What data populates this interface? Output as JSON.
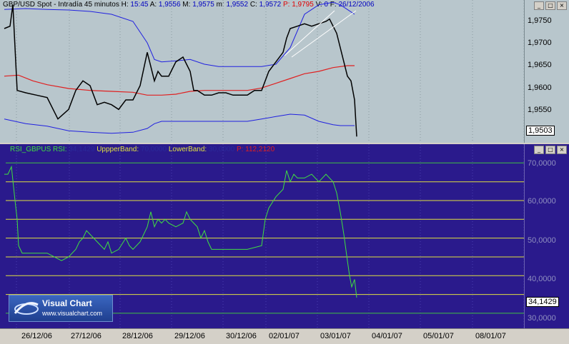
{
  "top_pane": {
    "header": {
      "symbol": "GBP/USD Spot - Intradía 45 minutos",
      "h_label": "H:",
      "h_value": "15:45",
      "a_label": "A:",
      "a_value": "1,9556",
      "m_label": "M:",
      "m_value": "1,9575",
      "mm_label": "m:",
      "mm_value": "1,9552",
      "c_label": "C:",
      "c_value": "1,9572",
      "p_label": "P:",
      "p_value": "1,9795",
      "v_label": "V:",
      "v_value": "0",
      "f_label": "F:",
      "f_value": "26/12/2006"
    },
    "axis_ticks": [
      "1,9750",
      "1,9700",
      "1,9650",
      "1,9600",
      "1,9550"
    ],
    "current_price": "1,9503",
    "window_buttons": [
      "_",
      "□",
      "×"
    ]
  },
  "rsi_pane": {
    "header": {
      "name": "RSI_GBPUS RSI:",
      "rsi_value": "34,1429",
      "upper_label": "UppperBand:",
      "upper_value": "70,0000",
      "lower_label": "LowerBand:",
      "lower_value": "30,0000",
      "p_label": "P:",
      "p_value": "112,2120"
    },
    "axis_ticks": [
      "70,0000",
      "60,0000",
      "50,0000",
      "40,0000",
      "30,0000"
    ],
    "current_value": "34,1429",
    "window_buttons": [
      "_",
      "□",
      "×"
    ]
  },
  "date_axis": [
    "26/12/06",
    "27/12/06",
    "28/12/06",
    "29/12/06",
    "30/12/06",
    "02/01/07",
    "03/01/07",
    "04/01/07",
    "05/01/07",
    "08/01/07"
  ],
  "logo": {
    "title": "Visual Chart",
    "url": "www.visualchart.com"
  },
  "colors": {
    "price_bg": "#b8c6cc",
    "rsi_bg": "#2a1a8c",
    "bands": "#2020e0",
    "ma": "#e02020",
    "rsi_line": "#40e040",
    "levels": "#e0e040"
  },
  "chart_data": [
    {
      "type": "line",
      "series": [
        {
          "name": "GBP/USD Spot",
          "x": [
            0,
            8,
            12,
            18,
            30,
            45,
            60,
            75,
            90,
            100,
            110,
            120,
            130,
            140,
            150,
            160,
            170,
            180,
            190,
            200,
            210,
            215,
            220,
            230,
            240,
            250,
            260,
            265,
            270,
            280,
            290,
            300,
            310,
            320,
            330,
            340,
            350,
            360,
            370,
            380,
            390,
            395,
            400,
            410,
            420,
            430,
            440,
            450,
            455,
            460,
            465,
            470,
            475,
            480,
            485,
            490,
            493
          ],
          "values": [
            1.973,
            1.9735,
            1.978,
            1.96,
            1.9595,
            1.959,
            1.9585,
            1.954,
            1.956,
            1.96,
            1.962,
            1.961,
            1.957,
            1.9575,
            1.957,
            1.956,
            1.958,
            1.958,
            1.961,
            1.968,
            1.962,
            1.964,
            1.963,
            1.963,
            1.966,
            1.967,
            1.964,
            1.96,
            1.96,
            1.959,
            1.959,
            1.9595,
            1.9595,
            1.959,
            1.959,
            1.959,
            1.96,
            1.96,
            1.964,
            1.966,
            1.968,
            1.971,
            1.973,
            1.9735,
            1.974,
            1.9735,
            1.974,
            1.9745,
            1.975,
            1.9735,
            1.972,
            1.969,
            1.966,
            1.963,
            1.962,
            1.958,
            1.9503
          ]
        },
        {
          "name": "Upper band",
          "x": [
            0,
            30,
            60,
            90,
            120,
            150,
            180,
            200,
            210,
            220,
            240,
            260,
            280,
            300,
            320,
            340,
            360,
            380,
            400,
            420,
            440,
            460,
            470,
            480,
            490
          ],
          "values": [
            1.977,
            1.9772,
            1.977,
            1.9769,
            1.9766,
            1.976,
            1.9745,
            1.97,
            1.9665,
            1.966,
            1.9662,
            1.9665,
            1.9655,
            1.965,
            1.965,
            1.965,
            1.965,
            1.9655,
            1.969,
            1.976,
            1.978,
            1.9785,
            1.978,
            1.977,
            1.976
          ]
        },
        {
          "name": "Lower band",
          "x": [
            0,
            30,
            60,
            90,
            120,
            150,
            180,
            200,
            210,
            220,
            240,
            260,
            280,
            300,
            320,
            340,
            360,
            380,
            400,
            420,
            440,
            460,
            470,
            480,
            490
          ],
          "values": [
            1.954,
            1.953,
            1.9525,
            1.9515,
            1.9512,
            1.951,
            1.9512,
            1.952,
            1.953,
            1.9535,
            1.9535,
            1.9535,
            1.9535,
            1.9535,
            1.9535,
            1.9535,
            1.954,
            1.9545,
            1.955,
            1.9548,
            1.9535,
            1.9528,
            1.9526,
            1.9526,
            1.9526
          ]
        },
        {
          "name": "Moving average",
          "x": [
            0,
            20,
            40,
            60,
            90,
            120,
            150,
            180,
            200,
            220,
            240,
            260,
            280,
            300,
            320,
            340,
            360,
            380,
            400,
            420,
            440,
            460,
            480,
            490
          ],
          "values": [
            1.963,
            1.9632,
            1.962,
            1.9612,
            1.9604,
            1.96,
            1.9598,
            1.9596,
            1.959,
            1.959,
            1.9592,
            1.9598,
            1.96,
            1.96,
            1.96,
            1.96,
            1.9605,
            1.9615,
            1.9625,
            1.9635,
            1.964,
            1.9648,
            1.9652,
            1.9652
          ]
        }
      ],
      "ylim": [
        1.949,
        1.979
      ]
    },
    {
      "type": "line",
      "series": [
        {
          "name": "RSI",
          "x": [
            0,
            5,
            10,
            15,
            18,
            20,
            25,
            40,
            60,
            80,
            90,
            100,
            105,
            110,
            115,
            120,
            125,
            130,
            140,
            145,
            150,
            160,
            170,
            175,
            180,
            190,
            200,
            205,
            210,
            215,
            220,
            225,
            230,
            240,
            250,
            255,
            260,
            265,
            270,
            275,
            280,
            285,
            290,
            300,
            320,
            340,
            360,
            365,
            370,
            380,
            390,
            395,
            400,
            405,
            410,
            420,
            430,
            440,
            450,
            460,
            465,
            470,
            475,
            480,
            483,
            486,
            490,
            493
          ],
          "values": [
            67,
            67,
            69,
            60,
            55,
            48,
            46,
            46,
            46,
            44,
            45,
            47,
            49,
            50,
            52,
            51,
            50,
            49,
            47,
            49,
            46,
            47,
            50,
            48,
            47,
            49,
            53,
            57,
            53,
            55,
            54,
            55,
            54,
            53,
            54,
            57,
            55,
            54,
            53,
            50,
            52,
            49,
            47,
            47,
            47,
            47,
            48,
            55,
            58,
            61,
            63,
            68,
            65,
            67,
            66,
            66,
            67,
            65,
            67,
            65,
            62,
            57,
            51,
            44,
            40,
            37,
            39,
            34.1429
          ]
        }
      ],
      "upper_band": 70,
      "lower_band": 30,
      "levels": [
        70,
        60,
        50,
        40,
        30
      ],
      "ylim": [
        26,
        75
      ]
    }
  ]
}
